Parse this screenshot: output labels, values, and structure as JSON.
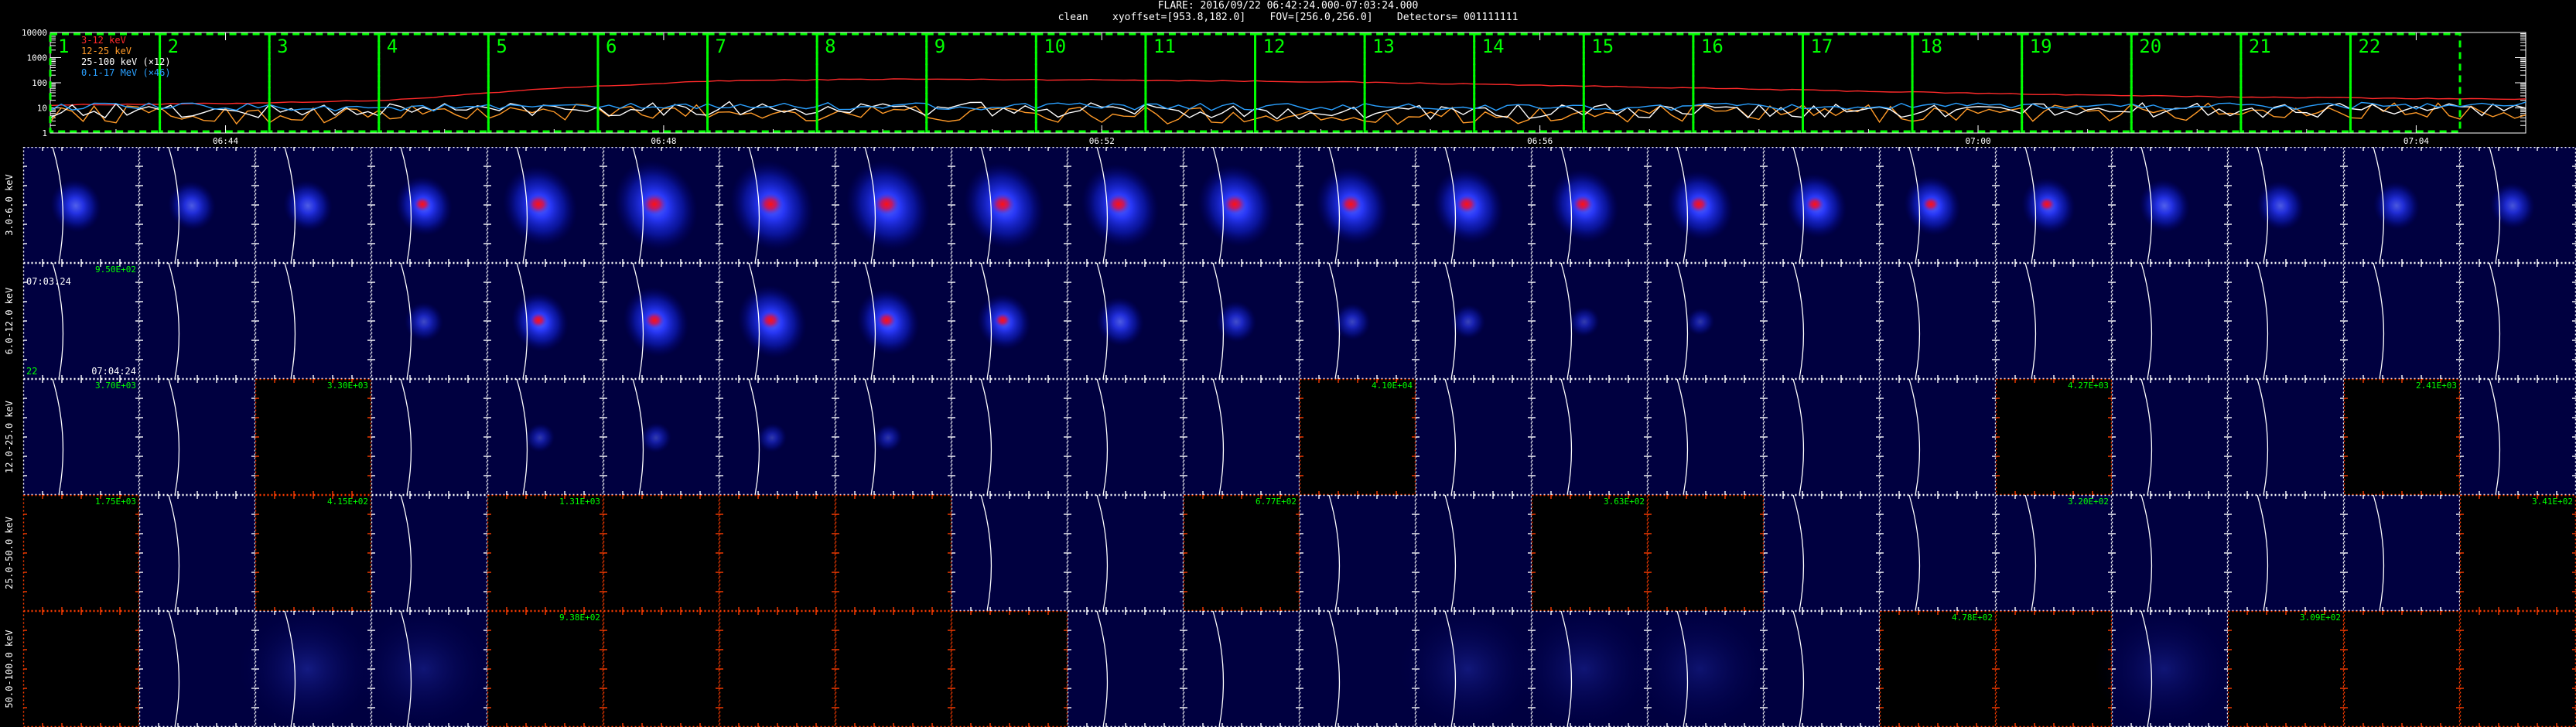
{
  "header": {
    "line1": "FLARE: 2016/09/22 06:42:24.000-07:03:24.000",
    "line2": "clean    xyoffset=[953.8,182.0]    FOV=[256.0,256.0]    Detectors= 001111111"
  },
  "colors": {
    "panel_bg": "#000040",
    "empty_panel_bg": "#000000",
    "empty_panel_border": "#ff3c00",
    "panel_tick": "#ffffff",
    "limb": "#ffffff",
    "interval_box": "#00ff00",
    "label_green": "#00ff00"
  },
  "chart_data": [
    {
      "type": "line",
      "ylog": true,
      "y_ticks": [
        "10000",
        "1000",
        "100",
        "10",
        "1"
      ],
      "ylim": [
        1,
        10000
      ],
      "time_range": [
        "06:42:24",
        "07:05:00"
      ],
      "time_ticks": [
        {
          "label": "06:44",
          "t": "06:44"
        },
        {
          "label": "06:48",
          "t": "06:48"
        },
        {
          "label": "06:52",
          "t": "06:52"
        },
        {
          "label": "06:56",
          "t": "06:56"
        },
        {
          "label": "07:00",
          "t": "07:00"
        },
        {
          "label": "07:04",
          "t": "07:04"
        }
      ],
      "legend": [
        {
          "name": "3-12 keV",
          "color": "#ff2a2a"
        },
        {
          "name": "12-25 keV",
          "color": "#ff9a28"
        },
        {
          "name": "25-100 keV (×12)",
          "color": "#ffffff"
        },
        {
          "name": "0.1-17 MeV (×46)",
          "color": "#2aa0ff"
        }
      ],
      "series": [
        {
          "name": "3-12 keV",
          "color": "#ff2a2a",
          "jitter": 0.02,
          "x": [
            "06:42:24",
            "06:44:00",
            "06:45:30",
            "06:47:00",
            "06:48:30",
            "06:50:00",
            "06:52:00",
            "06:54:00",
            "06:56:00",
            "06:58:00",
            "07:00:00",
            "07:02:00",
            "07:05:00"
          ],
          "y": [
            13,
            15,
            20,
            60,
            120,
            140,
            130,
            110,
            80,
            55,
            38,
            28,
            22
          ]
        },
        {
          "name": "12-25 keV",
          "color": "#ff9a28",
          "jitter": 0.35,
          "x": [
            "06:42:24",
            "06:44:00",
            "06:46:00",
            "06:48:00",
            "06:50:00",
            "06:52:00",
            "06:54:00",
            "06:56:00",
            "06:58:00",
            "07:00:00",
            "07:02:00",
            "07:05:00"
          ],
          "y": [
            6,
            5,
            6,
            7,
            6,
            5,
            5,
            5,
            6,
            6,
            7,
            8
          ]
        },
        {
          "name": "25-100 keV (×12)",
          "color": "#ffffff",
          "jitter": 0.3,
          "x": [
            "06:42:24",
            "06:44:00",
            "06:46:00",
            "06:48:00",
            "06:50:00",
            "06:52:00",
            "06:54:00",
            "06:56:00",
            "06:58:00",
            "07:00:00",
            "07:02:00",
            "07:05:00"
          ],
          "y": [
            8,
            7,
            9,
            10,
            9,
            8,
            7,
            7,
            7,
            8,
            8,
            9
          ]
        },
        {
          "name": "0.1-17 MeV (×46)",
          "color": "#2aa0ff",
          "jitter": 0.15,
          "x": [
            "06:42:24",
            "06:44:00",
            "06:46:00",
            "06:48:00",
            "06:50:00",
            "06:52:00",
            "06:54:00",
            "06:56:00",
            "06:58:00",
            "07:00:00",
            "07:02:00",
            "07:05:00"
          ],
          "y": [
            11,
            11,
            10,
            11,
            12,
            11,
            11,
            10,
            11,
            11,
            12,
            13
          ]
        }
      ],
      "intervals": [
        {
          "label": "1",
          "start": "06:42:24",
          "end": "06:43:24"
        },
        {
          "label": "2",
          "start": "06:43:24",
          "end": "06:44:24"
        },
        {
          "label": "3",
          "start": "06:44:24",
          "end": "06:45:24"
        },
        {
          "label": "4",
          "start": "06:45:24",
          "end": "06:46:24"
        },
        {
          "label": "5",
          "start": "06:46:24",
          "end": "06:47:24"
        },
        {
          "label": "6",
          "start": "06:47:24",
          "end": "06:48:24"
        },
        {
          "label": "7",
          "start": "06:48:24",
          "end": "06:49:24"
        },
        {
          "label": "8",
          "start": "06:49:24",
          "end": "06:50:24"
        },
        {
          "label": "9",
          "start": "06:50:24",
          "end": "06:51:24"
        },
        {
          "label": "10",
          "start": "06:51:24",
          "end": "06:52:24"
        },
        {
          "label": "11",
          "start": "06:52:24",
          "end": "06:53:24"
        },
        {
          "label": "12",
          "start": "06:53:24",
          "end": "06:54:24"
        },
        {
          "label": "13",
          "start": "06:54:24",
          "end": "06:55:24"
        },
        {
          "label": "14",
          "start": "06:55:24",
          "end": "06:56:24"
        },
        {
          "label": "15",
          "start": "06:56:24",
          "end": "06:57:24"
        },
        {
          "label": "16",
          "start": "06:57:24",
          "end": "06:58:24"
        },
        {
          "label": "17",
          "start": "06:58:24",
          "end": "06:59:24"
        },
        {
          "label": "18",
          "start": "06:59:24",
          "end": "07:00:24"
        },
        {
          "label": "19",
          "start": "07:00:24",
          "end": "07:01:24"
        },
        {
          "label": "20",
          "start": "07:01:24",
          "end": "07:02:24"
        },
        {
          "label": "21",
          "start": "07:02:24",
          "end": "07:03:24"
        },
        {
          "label": "22",
          "start": "07:03:24",
          "end": "07:04:24"
        }
      ]
    },
    {
      "type": "heatmap",
      "columns": 22,
      "energy_bands": [
        "3.0-6.0 keV",
        "6.0-12.0 keV",
        "12.0-25.0 keV",
        "25.0-50.0 keV",
        "50.0-100.0 keV"
      ],
      "panel_annotations": {
        "time_start": "07:03:24",
        "time_end": "07:04:24",
        "interval": "22"
      },
      "intensity": [
        [
          0.45,
          0.4,
          0.42,
          0.55,
          0.85,
          1.0,
          1.0,
          1.0,
          0.95,
          0.9,
          0.88,
          0.82,
          0.78,
          0.75,
          0.7,
          0.62,
          0.55,
          0.5,
          0.45,
          0.4,
          0.38,
          0.35
        ],
        [
          0,
          0,
          0,
          0.25,
          0.55,
          0.7,
          0.75,
          0.65,
          0.5,
          0.4,
          0.28,
          0.22,
          0.18,
          0.12,
          0.08,
          0,
          0,
          0,
          0,
          0,
          0,
          0
        ],
        [
          0,
          0,
          0,
          0,
          0.1,
          0.12,
          0.1,
          0.08,
          0,
          0,
          0,
          0,
          0,
          0,
          0,
          0,
          0,
          0,
          0,
          0,
          0,
          0
        ],
        [
          0,
          0,
          0,
          0,
          0,
          0,
          0,
          0,
          0,
          0,
          0,
          0,
          0,
          0,
          0,
          0,
          0,
          0,
          0,
          0,
          0,
          0
        ],
        [
          0,
          0,
          0.25,
          0.2,
          0,
          0,
          0,
          0,
          0,
          0,
          0,
          0,
          0.22,
          0.2,
          0.18,
          0,
          0,
          0,
          0.2,
          0,
          0,
          0
        ]
      ],
      "empty_panels": [
        {
          "band": 2,
          "col": 2
        },
        {
          "band": 2,
          "col": 11
        },
        {
          "band": 2,
          "col": 17
        },
        {
          "band": 2,
          "col": 20
        },
        {
          "band": 3,
          "col": 0
        },
        {
          "band": 3,
          "col": 2
        },
        {
          "band": 3,
          "col": 4
        },
        {
          "band": 3,
          "col": 5
        },
        {
          "band": 3,
          "col": 6
        },
        {
          "band": 3,
          "col": 7
        },
        {
          "band": 3,
          "col": 10
        },
        {
          "band": 3,
          "col": 13
        },
        {
          "band": 3,
          "col": 14
        },
        {
          "band": 3,
          "col": 21
        },
        {
          "band": 4,
          "col": 0
        },
        {
          "band": 4,
          "col": 4
        },
        {
          "band": 4,
          "col": 5
        },
        {
          "band": 4,
          "col": 6
        },
        {
          "band": 4,
          "col": 7
        },
        {
          "band": 4,
          "col": 8
        },
        {
          "band": 4,
          "col": 16
        },
        {
          "band": 4,
          "col": 17
        },
        {
          "band": 4,
          "col": 19
        },
        {
          "band": 4,
          "col": 20
        },
        {
          "band": 4,
          "col": 21
        }
      ],
      "peak_labels": [
        {
          "band": 1,
          "col": 0,
          "text": "9.50E+02"
        },
        {
          "band": 2,
          "col": 0,
          "text": "3.70E+03"
        },
        {
          "band": 2,
          "col": 2,
          "text": "3.30E+03"
        },
        {
          "band": 2,
          "col": 11,
          "text": "4.10E+04"
        },
        {
          "band": 2,
          "col": 17,
          "text": "4.27E+03"
        },
        {
          "band": 2,
          "col": 20,
          "text": "2.41E+03"
        },
        {
          "band": 3,
          "col": 0,
          "text": "1.75E+03"
        },
        {
          "band": 3,
          "col": 2,
          "text": "4.15E+02"
        },
        {
          "band": 3,
          "col": 4,
          "text": "1.31E+03"
        },
        {
          "band": 3,
          "col": 10,
          "text": "6.77E+02"
        },
        {
          "band": 3,
          "col": 13,
          "text": "3.63E+02"
        },
        {
          "band": 3,
          "col": 17,
          "text": "3.20E+02"
        },
        {
          "band": 3,
          "col": 21,
          "text": "3.41E+02"
        },
        {
          "band": 4,
          "col": 4,
          "text": "9.38E+02"
        },
        {
          "band": 4,
          "col": 16,
          "text": "4.78E+02"
        },
        {
          "band": 4,
          "col": 19,
          "text": "3.09E+02"
        }
      ]
    }
  ]
}
